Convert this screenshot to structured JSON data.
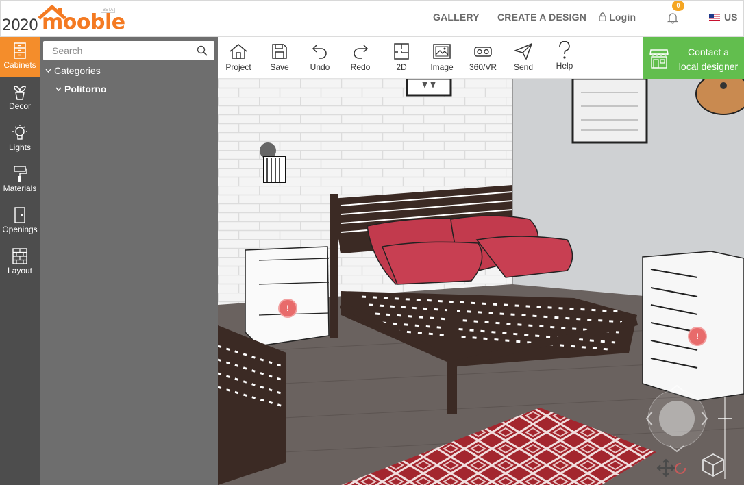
{
  "app": {
    "brand_number": "2020",
    "brand_name": "mooble",
    "beta": "BETA"
  },
  "header": {
    "gallery": "GALLERY",
    "create_design": "CREATE A DESIGN",
    "login": "Login",
    "notification_count": "0",
    "region": "US"
  },
  "rail": {
    "items": [
      {
        "label": "Cabinets",
        "icon": "cabinet-icon",
        "active": true
      },
      {
        "label": "Decor",
        "icon": "plant-icon"
      },
      {
        "label": "Lights",
        "icon": "bulb-icon"
      },
      {
        "label": "Materials",
        "icon": "paint-roller-icon"
      },
      {
        "label": "Openings",
        "icon": "door-icon"
      },
      {
        "label": "Layout",
        "icon": "brick-wall-icon"
      }
    ]
  },
  "catalog": {
    "search_placeholder": "Search",
    "categories_label": "Categories",
    "selected_category": "Politorno"
  },
  "toolbar": {
    "items": [
      {
        "label": "Project",
        "icon": "home-icon"
      },
      {
        "label": "Save",
        "icon": "floppy-icon"
      },
      {
        "label": "Undo",
        "icon": "undo-icon"
      },
      {
        "label": "Redo",
        "icon": "redo-icon"
      },
      {
        "label": "2D",
        "icon": "floorplan-2d-icon"
      },
      {
        "label": "Image",
        "icon": "image-icon"
      },
      {
        "label": "360/VR",
        "icon": "vr-headset-icon"
      },
      {
        "label": "Send",
        "icon": "paper-plane-icon"
      },
      {
        "label": "Help",
        "icon": "question-icon"
      }
    ],
    "contact_line1": "Contact a",
    "contact_line2": "local designer"
  },
  "viewport": {
    "hotspot_glyph": "!",
    "colors": {
      "brick_wall": "#f3f3f3",
      "grey_wall": "#cfd1d3",
      "floor": "#6a625f",
      "bed_frame": "#3b2a24",
      "pillows": "#c23a4d",
      "rug_red": "#a3262e"
    }
  },
  "colors": {
    "accent_orange": "#f48d2b",
    "contact_green": "#62be4e",
    "rail_bg": "#4d4d4d",
    "panel_bg": "#6e6e6e"
  }
}
